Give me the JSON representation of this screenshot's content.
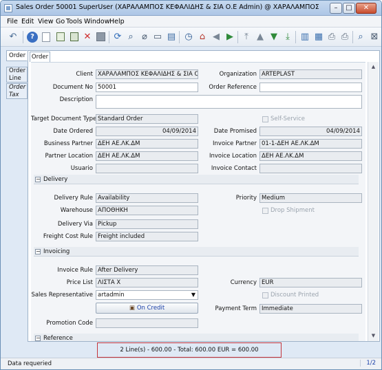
{
  "window": {
    "title": "Sales Order  50001  SuperUser (ΧΑΡΑΛΑΜΠΟΣ ΚΕΦΑΛΙΔΗΣ & ΣΙΑ Ο.Ε Admin) @ ΧΑΡΑΛΑΜΠΟΣ ΚΕΦΑΛΙΔΗΣ & ΣΙ...",
    "minimize": "–",
    "maximize": "□",
    "close": "✕"
  },
  "menu": [
    "File",
    "Edit",
    "View",
    "Go",
    "Tools",
    "Window",
    "Help"
  ],
  "toolbar_icons": [
    "undo-icon",
    "help-icon",
    "new-record-icon",
    "copy-record-icon",
    "delete-icon",
    "save-icon",
    "refresh-icon",
    "find-icon",
    "attachment-icon",
    "chat-icon",
    "grid-toggle-icon",
    "history-icon",
    "home-icon",
    "previous-icon",
    "next-icon",
    "first-record-icon",
    "previous-record-icon",
    "next-record-icon",
    "last-record-icon",
    "report-icon",
    "archive-icon",
    "print-preview-icon",
    "print-icon",
    "zoom-across-icon",
    "close-window-icon"
  ],
  "left_tabs": {
    "order": "Order",
    "order_line": "Order Line",
    "order_tax": "Order Tax"
  },
  "content_tab": "Order",
  "form": {
    "client_label": "Client",
    "client_value": "ΧΑΡΑΛΑΜΠΟΣ ΚΕΦΑΛΙΔΗΣ & ΣΙΑ Ο.Ε",
    "organization_label": "Organization",
    "organization_value": "ARTEPLAST",
    "document_no_label": "Document No",
    "document_no_value": "50001",
    "order_reference_label": "Order Reference",
    "order_reference_value": "",
    "description_label": "Description",
    "description_value": "",
    "target_doc_type_label": "Target Document Type",
    "target_doc_type_value": "Standard Order",
    "self_service_label": "Self-Service",
    "date_ordered_label": "Date Ordered",
    "date_ordered_value": "04/09/2014",
    "date_promised_label": "Date Promised",
    "date_promised_value": "04/09/2014",
    "business_partner_label": "Business Partner",
    "business_partner_value": "ΔΕΗ ΑΕ.ΛΚ.ΔΜ",
    "invoice_partner_label": "Invoice Partner",
    "invoice_partner_value": "01-1-ΔΕΗ ΑΕ.ΛΚ.ΔΜ",
    "partner_location_label": "Partner Location",
    "partner_location_value": "ΔΕΗ ΑΕ.ΛΚ.ΔΜ",
    "invoice_location_label": "Invoice Location",
    "invoice_location_value": "ΔΕΗ ΑΕ.ΛΚ.ΔΜ",
    "usuario_label": "Usuario",
    "usuario_value": "",
    "invoice_contact_label": "Invoice Contact",
    "invoice_contact_value": ""
  },
  "delivery": {
    "section_title": "Delivery",
    "toggle": "−",
    "delivery_rule_label": "Delivery Rule",
    "delivery_rule_value": "Availability",
    "priority_label": "Priority",
    "priority_value": "Medium",
    "warehouse_label": "Warehouse",
    "warehouse_value": "ΑΠΟΘΗΚΗ",
    "drop_shipment_label": "Drop Shipment",
    "delivery_via_label": "Delivery Via",
    "delivery_via_value": "Pickup",
    "freight_cost_rule_label": "Freight Cost Rule",
    "freight_cost_rule_value": "Freight included"
  },
  "invoicing": {
    "section_title": "Invoicing",
    "toggle": "−",
    "invoice_rule_label": "Invoice Rule",
    "invoice_rule_value": "After Delivery",
    "price_list_label": "Price List",
    "price_list_value": "ΛΙΣΤΑ Χ",
    "currency_label": "Currency",
    "currency_value": "EUR",
    "sales_rep_label": "Sales Representative",
    "sales_rep_value": "artadmin",
    "invoice_printed_label": "Discount Printed",
    "on_credit_label": "On Credit",
    "payment_term_label": "Payment Term",
    "payment_term_value": "Immediate",
    "promotion_code_label": "Promotion Code",
    "promotion_code_value": ""
  },
  "reference": {
    "section_title": "Reference",
    "toggle": "−"
  },
  "footer": {
    "total_text": "2 Line(s) - 600.00 -  Total: 600.00  EUR  =  600.00"
  },
  "status": {
    "message": "Data requeried",
    "page": "1/2"
  }
}
